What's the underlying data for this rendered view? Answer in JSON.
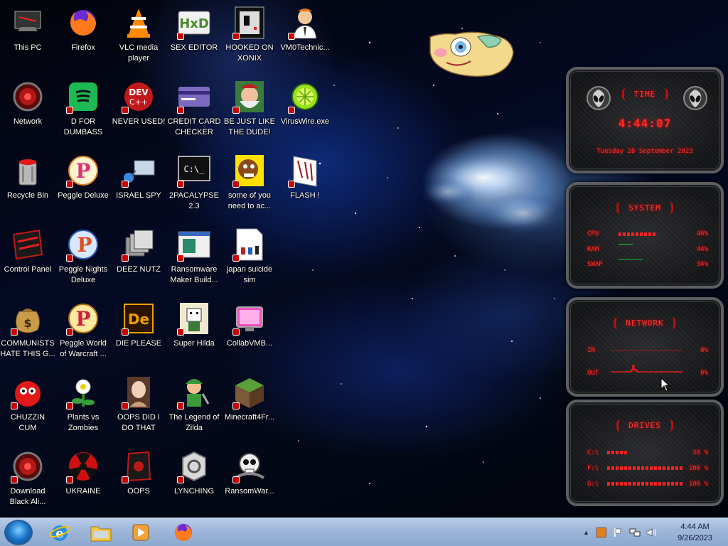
{
  "desktop": {
    "icons": [
      {
        "id": "this-pc",
        "label": "This PC"
      },
      {
        "id": "firefox",
        "label": "Firefox"
      },
      {
        "id": "vlc",
        "label": "VLC media\nplayer"
      },
      {
        "id": "sex-editor",
        "label": "SEX EDITOR"
      },
      {
        "id": "hooked-on-xonix",
        "label": "HOOKED ON\nXONIX"
      },
      {
        "id": "vm0technic",
        "label": "VM0Technic..."
      },
      {
        "id": "network",
        "label": "Network"
      },
      {
        "id": "d-for-dumbass",
        "label": "D FOR\nDUMBASS"
      },
      {
        "id": "never-used",
        "label": "NEVER USED!"
      },
      {
        "id": "credit-card-checker",
        "label": "CREDIT CARD\nCHECKER"
      },
      {
        "id": "be-just-like-the-dude",
        "label": "BE JUST LIKE\nTHE DUDE!"
      },
      {
        "id": "viruswire",
        "label": "VirusWire.exe"
      },
      {
        "id": "recycle-bin",
        "label": "Recycle Bin"
      },
      {
        "id": "peggle-deluxe",
        "label": "Peggle Deluxe"
      },
      {
        "id": "israel-spy",
        "label": "ISRAEL SPY"
      },
      {
        "id": "2pacalypse",
        "label": "2PACALYPSE\n2.3"
      },
      {
        "id": "some-of-you",
        "label": "some of you\nneed to ac..."
      },
      {
        "id": "flash",
        "label": "FLASH !"
      },
      {
        "id": "control-panel",
        "label": "Control Panel"
      },
      {
        "id": "peggle-nights",
        "label": "Peggle Nights\nDeluxe"
      },
      {
        "id": "deez-nutz",
        "label": "DEEZ NUTZ"
      },
      {
        "id": "ransomware-maker",
        "label": "Ransomware\nMaker Build..."
      },
      {
        "id": "japan-suicide-sim",
        "label": "japan suicide\nsim"
      },
      {
        "id": "communists",
        "label": "COMMUNISTS\nHATE THIS G..."
      },
      {
        "id": "peggle-world",
        "label": "Peggle World\nof Warcraft ..."
      },
      {
        "id": "die-please",
        "label": "DIE PLEASE"
      },
      {
        "id": "super-hilda",
        "label": "Super Hilda"
      },
      {
        "id": "collabvmb",
        "label": "CollabVMB..."
      },
      {
        "id": "chuzzin-cum",
        "label": "CHUZZIN\nCUM"
      },
      {
        "id": "plants-vs-zombies",
        "label": "Plants vs\nZombies"
      },
      {
        "id": "oops-did-i",
        "label": "OOPS DID I\nDO THAT"
      },
      {
        "id": "legend-of-zilda",
        "label": "The Legend of\nZilda"
      },
      {
        "id": "minecraft4fr",
        "label": "Minecraft4Fr..."
      },
      {
        "id": "download-black-ali",
        "label": "Download\nBlack Ali..."
      },
      {
        "id": "ukraine",
        "label": "UKRAINE"
      },
      {
        "id": "oops",
        "label": "OOPS"
      },
      {
        "id": "lynching",
        "label": "LYNCHING"
      },
      {
        "id": "ransomwar",
        "label": "RansomWar..."
      }
    ]
  },
  "gadgets": {
    "time": {
      "title": "TIME",
      "clock": "4:44:07",
      "date": "Tuesday 26 September 2023"
    },
    "system": {
      "title": "SYSTEM",
      "cpu_label": "CPU",
      "cpu_val": "46%",
      "ram_label": "RAM",
      "ram_val": "44%",
      "swap_label": "SWAP",
      "swap_val": "34%"
    },
    "network": {
      "title": "NETWORK",
      "in_label": "IN",
      "in_val": "0%",
      "out_label": "OUT",
      "out_val": "0%"
    },
    "drives": {
      "title": "DRIVES",
      "c_label": "C:\\",
      "c_val": "28 %",
      "f_label": "F:\\",
      "f_val": "100 %",
      "g_label": "G:\\",
      "g_val": "100 %"
    }
  },
  "taskbar": {
    "time": "4:44 AM",
    "date": "9/26/2023",
    "pinned": [
      "internet-explorer",
      "file-explorer",
      "media-player",
      "firefox"
    ]
  },
  "colors": {
    "accent_red": "#ff2a2a",
    "taskbar": "#a5bcdc"
  }
}
